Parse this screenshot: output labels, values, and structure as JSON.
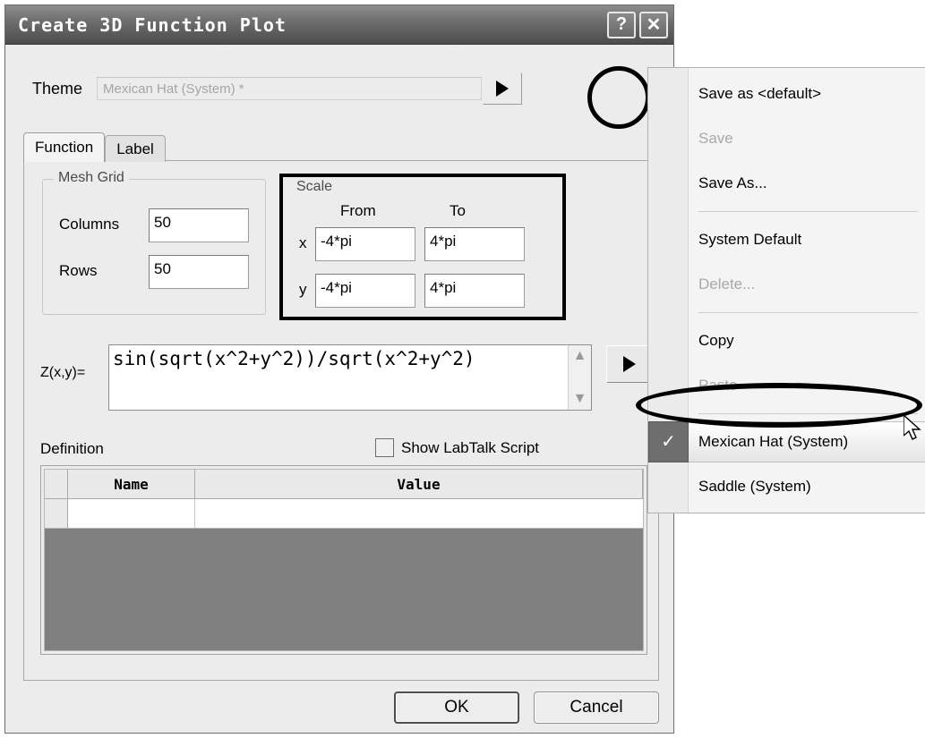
{
  "window": {
    "title": "Create 3D Function Plot",
    "help_button": "?",
    "close_button": "✕"
  },
  "theme": {
    "label": "Theme",
    "value": "Mexican Hat (System) *",
    "placeholder": "Mexican Hat (System) *",
    "dropdown_arrow_icon": "triangle-right-icon"
  },
  "tabs": [
    {
      "label": "Function",
      "active": true
    },
    {
      "label": "Label",
      "active": false
    }
  ],
  "mesh_grid": {
    "title": "Mesh Grid",
    "columns_label": "Columns",
    "columns_value": "50",
    "rows_label": "Rows",
    "rows_value": "50"
  },
  "scale": {
    "title": "Scale",
    "col_from": "From",
    "col_to": "To",
    "x_label": "x",
    "x_from": "-4*pi",
    "x_to": "4*pi",
    "y_label": "y",
    "y_from": "-4*pi",
    "y_to": "4*pi"
  },
  "formula": {
    "label": "Z(x,y)=",
    "value": "sin(sqrt(x^2+y^2))/sqrt(x^2+y^2)",
    "scroll_up_icon": "chevron-up-icon",
    "scroll_down_icon": "chevron-down-icon",
    "expand_arrow_icon": "triangle-right-icon"
  },
  "definition": {
    "label": "Definition",
    "show_labtalk_label": "Show LabTalk Script",
    "show_labtalk_checked": false,
    "table": {
      "headers": [
        "Name",
        "Value"
      ],
      "rows": [
        {
          "name": "",
          "value": ""
        }
      ]
    }
  },
  "buttons": {
    "ok": "OK",
    "cancel": "Cancel"
  },
  "menu": {
    "items": [
      {
        "label": "Save as <default>",
        "disabled": false,
        "checked": false
      },
      {
        "label": "Save",
        "disabled": true,
        "checked": false
      },
      {
        "label": "Save As...",
        "disabled": false,
        "checked": false
      },
      {
        "separator": true
      },
      {
        "label": "System Default",
        "disabled": false,
        "checked": false
      },
      {
        "label": "Delete...",
        "disabled": true,
        "checked": false
      },
      {
        "separator": true
      },
      {
        "label": "Copy",
        "disabled": false,
        "checked": false
      },
      {
        "label": "Paste",
        "disabled": true,
        "checked": false
      },
      {
        "separator": true
      },
      {
        "label": "Mexican Hat (System)",
        "disabled": false,
        "checked": true
      },
      {
        "label": "Saddle (System)",
        "disabled": false,
        "checked": false
      }
    ],
    "check_glyph": "✓"
  },
  "annotations": {
    "theme_arrow_circle": "circle-highlight",
    "mexican_hat_ellipse": "ellipse-highlight"
  },
  "colors": {
    "dialog_face": "#ececec",
    "titlebar": "#6f6f6f",
    "table_empty_area": "#808080",
    "annotation": "#000000"
  }
}
